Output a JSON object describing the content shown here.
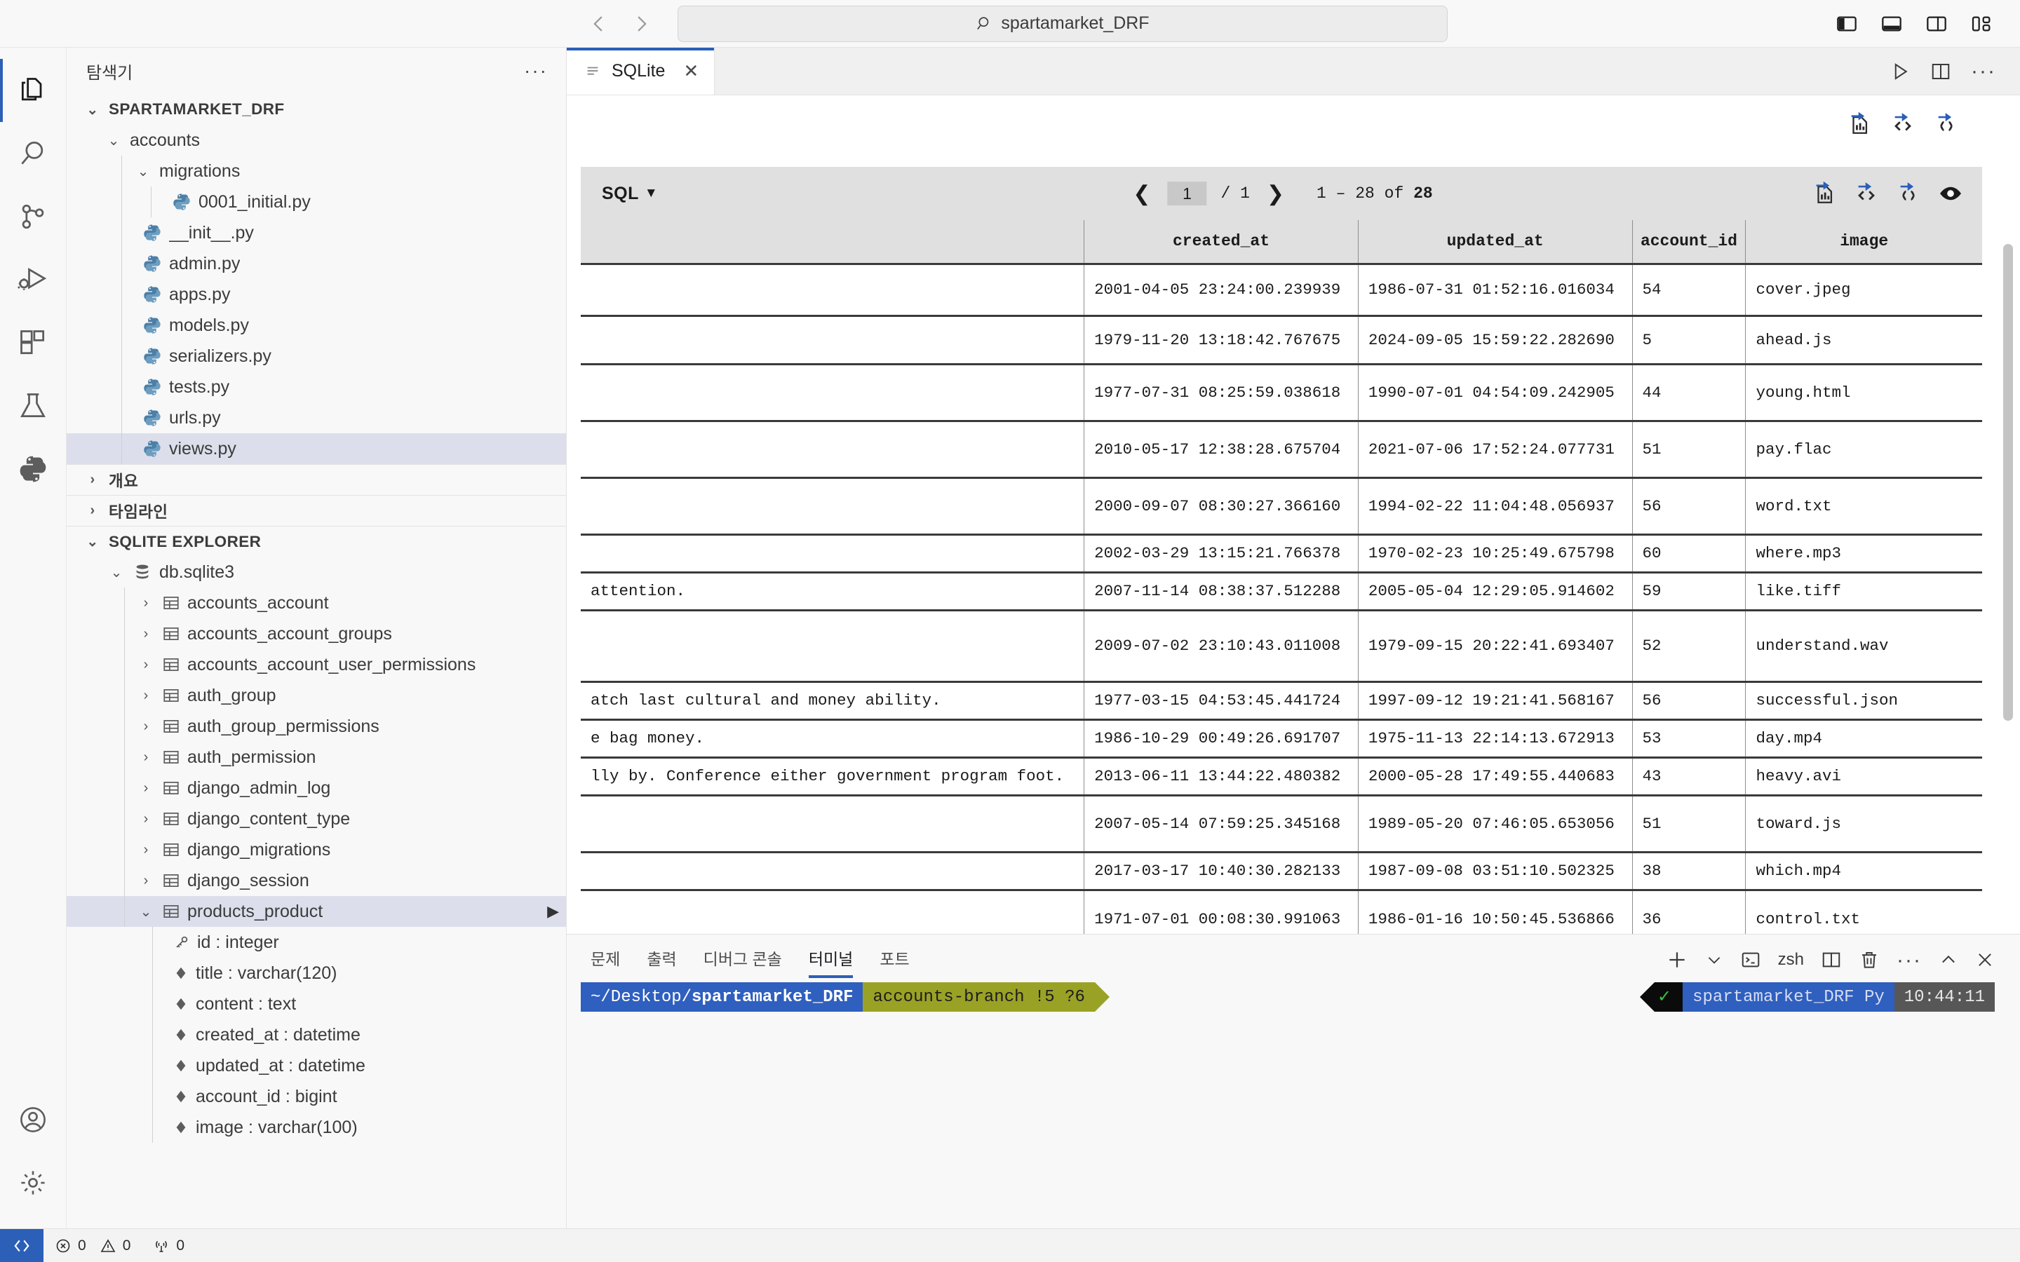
{
  "titlebar": {
    "back_icon": "arrow-left-icon",
    "forward_icon": "arrow-right-icon",
    "command_center_value": "spartamarket_DRF",
    "command_center_placeholder": "Search",
    "layout_icons": [
      "toggle-primary-sidebar-icon",
      "toggle-panel-icon",
      "toggle-secondary-sidebar-icon",
      "customize-layout-icon"
    ]
  },
  "activitybar": {
    "items": [
      {
        "name": "explorer",
        "icon": "files-icon",
        "active": true
      },
      {
        "name": "search",
        "icon": "search-icon",
        "active": false
      },
      {
        "name": "source-control",
        "icon": "source-control-icon",
        "active": false
      },
      {
        "name": "run-and-debug",
        "icon": "run-debug-icon",
        "active": false
      },
      {
        "name": "extensions",
        "icon": "extensions-icon",
        "active": false
      },
      {
        "name": "testing",
        "icon": "beaker-icon",
        "active": false
      },
      {
        "name": "python",
        "icon": "python-icon",
        "active": false
      }
    ],
    "bottom": [
      {
        "name": "accounts",
        "icon": "account-icon"
      },
      {
        "name": "manage",
        "icon": "gear-icon"
      }
    ]
  },
  "sidebar": {
    "title": "탐색기",
    "more_label": "···",
    "sections": [
      {
        "label": "SPARTAMARKET_DRF",
        "expanded": true,
        "type": "folder-root"
      }
    ],
    "explorer_tree": [
      {
        "label": "SPARTAMARKET_DRF",
        "indent": 0,
        "kind": "root",
        "chev": "v",
        "bold": true
      },
      {
        "label": "accounts",
        "indent": 1,
        "kind": "folder",
        "chev": "v"
      },
      {
        "label": "migrations",
        "indent": 2,
        "kind": "folder",
        "chev": "v"
      },
      {
        "label": "0001_initial.py",
        "indent": 4,
        "kind": "py"
      },
      {
        "label": "__init__.py",
        "indent": 3,
        "kind": "py"
      },
      {
        "label": "admin.py",
        "indent": 3,
        "kind": "py"
      },
      {
        "label": "apps.py",
        "indent": 3,
        "kind": "py"
      },
      {
        "label": "models.py",
        "indent": 3,
        "kind": "py"
      },
      {
        "label": "serializers.py",
        "indent": 3,
        "kind": "py"
      },
      {
        "label": "tests.py",
        "indent": 3,
        "kind": "py"
      },
      {
        "label": "urls.py",
        "indent": 3,
        "kind": "py"
      },
      {
        "label": "views.py",
        "indent": 3,
        "kind": "py",
        "selected": true
      }
    ],
    "collapsed_sections": [
      {
        "label": "개요",
        "chev": ">"
      },
      {
        "label": "타임라인",
        "chev": ">"
      }
    ],
    "sqlite_explorer": {
      "label": "SQLITE EXPLORER",
      "chev": "v",
      "database": {
        "label": "db.sqlite3",
        "chev": "v",
        "icon": "database-icon"
      },
      "tables": [
        {
          "label": "accounts_account",
          "chev": ">"
        },
        {
          "label": "accounts_account_groups",
          "chev": ">"
        },
        {
          "label": "accounts_account_user_permissions",
          "chev": ">"
        },
        {
          "label": "auth_group",
          "chev": ">"
        },
        {
          "label": "auth_group_permissions",
          "chev": ">"
        },
        {
          "label": "auth_permission",
          "chev": ">"
        },
        {
          "label": "django_admin_log",
          "chev": ">"
        },
        {
          "label": "django_content_type",
          "chev": ">"
        },
        {
          "label": "django_migrations",
          "chev": ">"
        },
        {
          "label": "django_session",
          "chev": ">"
        },
        {
          "label": "products_product",
          "chev": "v",
          "selected": true,
          "has_run_action": true
        }
      ],
      "columns": [
        {
          "label": "id : integer",
          "icon": "key-icon"
        },
        {
          "label": "title : varchar(120)",
          "icon": "diamond-icon"
        },
        {
          "label": "content : text",
          "icon": "diamond-icon"
        },
        {
          "label": "created_at : datetime",
          "icon": "diamond-icon"
        },
        {
          "label": "updated_at : datetime",
          "icon": "diamond-icon"
        },
        {
          "label": "account_id : bigint",
          "icon": "diamond-icon"
        },
        {
          "label": "image : varchar(100)",
          "icon": "diamond-icon"
        }
      ]
    }
  },
  "editor": {
    "tab": {
      "label": "SQLite",
      "icon": "list-icon",
      "close_icon": "close-icon"
    },
    "tab_actions": [
      "run-query-icon",
      "split-editor-icon",
      "more-actions-icon"
    ],
    "viewer_tools": [
      "export-csv-icon",
      "export-html-icon",
      "export-json-icon"
    ]
  },
  "grid": {
    "sql_button": "SQL",
    "sql_caret": "▼",
    "prev_icon": "chevron-left-icon",
    "next_icon": "chevron-right-icon",
    "page_value": "1",
    "page_total": "/ 1",
    "range_prefix": "1 – 28 of ",
    "range_total": "28",
    "toolbar_icons": [
      "export-csv-icon",
      "export-html-icon",
      "export-json-icon",
      "show-hide-columns-icon"
    ],
    "columns": [
      "",
      "created_at",
      "updated_at",
      "account_id",
      "image"
    ],
    "rows": [
      {
        "content": "",
        "created_at": "2001-04-05 23:24:00.239939",
        "updated_at": "1986-07-31 01:52:16.016034",
        "account_id": "54",
        "image": "cover.jpeg",
        "tall": true
      },
      {
        "content": "",
        "created_at": "1979-11-20 13:18:42.767675",
        "updated_at": "2024-09-05 15:59:22.282690",
        "account_id": "5",
        "image": "ahead.js",
        "tall": false
      },
      {
        "content": "",
        "created_at": "1977-07-31 08:25:59.038618",
        "updated_at": "1990-07-01 04:54:09.242905",
        "account_id": "44",
        "image": "young.html",
        "tall": true
      },
      {
        "content": "",
        "created_at": "2010-05-17 12:38:28.675704",
        "updated_at": "2021-07-06 17:52:24.077731",
        "account_id": "51",
        "image": "pay.flac",
        "tall": true
      },
      {
        "content": "",
        "created_at": "2000-09-07 08:30:27.366160",
        "updated_at": "1994-02-22 11:04:48.056937",
        "account_id": "56",
        "image": "word.txt",
        "tall": true
      },
      {
        "content": "",
        "created_at": "2002-03-29 13:15:21.766378",
        "updated_at": "1970-02-23 10:25:49.675798",
        "account_id": "60",
        "image": "where.mp3",
        "tall": false
      },
      {
        "content": "attention.",
        "created_at": "2007-11-14 08:38:37.512288",
        "updated_at": "2005-05-04 12:29:05.914602",
        "account_id": "59",
        "image": "like.tiff",
        "tall": false
      },
      {
        "content": "",
        "created_at": "2009-07-02 23:10:43.011008",
        "updated_at": "1979-09-15 20:22:41.693407",
        "account_id": "52",
        "image": "understand.wav",
        "tall": true
      },
      {
        "content": "atch last cultural and money ability.",
        "created_at": "1977-03-15 04:53:45.441724",
        "updated_at": "1997-09-12 19:21:41.568167",
        "account_id": "56",
        "image": "successful.json",
        "tall": false
      },
      {
        "content": "e bag money.",
        "created_at": "1986-10-29 00:49:26.691707",
        "updated_at": "1975-11-13 22:14:13.672913",
        "account_id": "53",
        "image": "day.mp4",
        "tall": false
      },
      {
        "content": "lly by. Conference either government program foot.",
        "created_at": "2013-06-11 13:44:22.480382",
        "updated_at": "2000-05-28 17:49:55.440683",
        "account_id": "43",
        "image": "heavy.avi",
        "tall": false
      },
      {
        "content": "",
        "created_at": "2007-05-14 07:59:25.345168",
        "updated_at": "1989-05-20 07:46:05.653056",
        "account_id": "51",
        "image": "toward.js",
        "tall": true
      },
      {
        "content": "",
        "created_at": "2017-03-17 10:40:30.282133",
        "updated_at": "1987-09-08 03:51:10.502325",
        "account_id": "38",
        "image": "which.mp4",
        "tall": false
      },
      {
        "content": "",
        "created_at": "1971-07-01 00:08:30.991063",
        "updated_at": "1986-01-16 10:50:45.536866",
        "account_id": "36",
        "image": "control.txt",
        "tall": true
      }
    ]
  },
  "panel": {
    "tabs": [
      {
        "label": "문제",
        "active": false
      },
      {
        "label": "출력",
        "active": false
      },
      {
        "label": "디버그 콘솔",
        "active": false
      },
      {
        "label": "터미널",
        "active": true
      },
      {
        "label": "포트",
        "active": false
      }
    ],
    "actions": [
      {
        "name": "new-terminal",
        "icon": "plus-icon"
      },
      {
        "name": "new-terminal-dropdown",
        "icon": "chevron-down-icon"
      },
      {
        "name": "shell-type",
        "icon": "terminal-icon",
        "label": "zsh"
      },
      {
        "name": "split-terminal",
        "icon": "split-icon"
      },
      {
        "name": "kill-terminal",
        "icon": "trash-icon"
      },
      {
        "name": "more-actions",
        "icon": "ellipsis-icon"
      },
      {
        "name": "maximize-panel",
        "icon": "chevron-up-icon"
      },
      {
        "name": "close-panel",
        "icon": "close-icon"
      }
    ],
    "terminal": {
      "path": "~/Desktop/",
      "path_bold": "spartamarket_DRF",
      "branch": "accounts-branch !5 ?6",
      "status_check": "✓",
      "env": "spartamarket_DRF Py",
      "time": "10:44:11"
    }
  },
  "statusbar": {
    "remote_icon": "remote-window-icon",
    "errors": "0",
    "warnings": "0",
    "ports": "0",
    "error_icon": "error-icon",
    "warning_icon": "warning-icon",
    "ports_icon": "radio-tower-icon"
  },
  "colors": {
    "accent": "#2b5fb8",
    "tab_active_border": "#2b5fb8",
    "toolbar_bg": "#e0e0e0",
    "selection": "#dcdfeb",
    "terminal_path_bg": "#2f5fbf",
    "terminal_branch_bg": "#9aa226",
    "terminal_time_bg": "#575757",
    "icon_blue": "#2b5fb8"
  }
}
